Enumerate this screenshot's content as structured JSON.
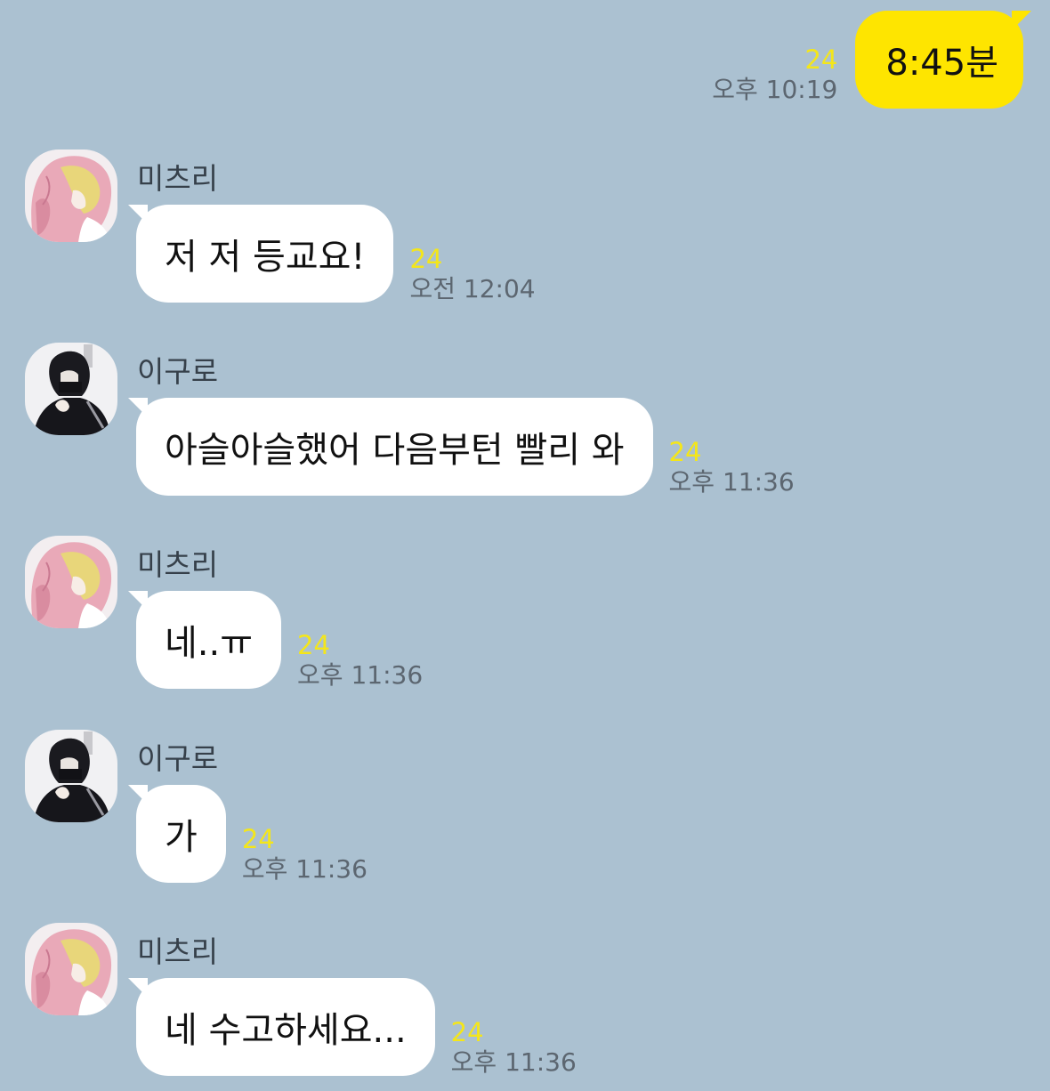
{
  "chat": {
    "outgoing": {
      "text": "8:45분",
      "unread": "24",
      "time": "오후 10:19"
    },
    "messages": [
      {
        "sender": "미츠리",
        "avatar": "pink-hair-avatar",
        "text": "저 저 등교요!",
        "unread": "24",
        "time": "오전 12:04"
      },
      {
        "sender": "이구로",
        "avatar": "dark-hair-avatar",
        "text": "아슬아슬했어 다음부턴 빨리 와",
        "unread": "24",
        "time": "오후 11:36"
      },
      {
        "sender": "미츠리",
        "avatar": "pink-hair-avatar",
        "text": "네..ㅠ",
        "unread": "24",
        "time": "오후 11:36"
      },
      {
        "sender": "이구로",
        "avatar": "dark-hair-avatar",
        "text": "가",
        "unread": "24",
        "time": "오후 11:36"
      },
      {
        "sender": "미츠리",
        "avatar": "pink-hair-avatar",
        "text": "네 수고하세요...",
        "unread": "24",
        "time": "오후 11:36"
      }
    ]
  },
  "colors": {
    "background": "#abc1d1",
    "outgoing_bubble": "#fee500",
    "incoming_bubble": "#ffffff",
    "unread_count": "#f4e61a"
  }
}
